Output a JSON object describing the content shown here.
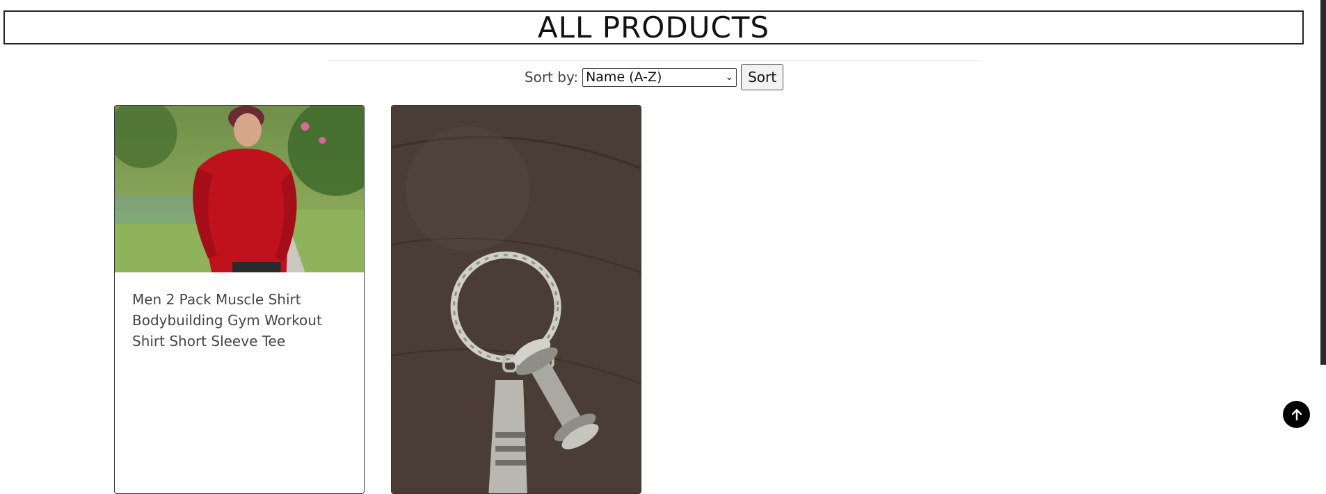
{
  "page": {
    "title": "ALL PRODUCTS"
  },
  "sort": {
    "label": "Sort by:",
    "selected": "Name (A-Z)",
    "button_label": "Sort"
  },
  "products": [
    {
      "name": "Men 2 Pack Muscle Shirt Bodybuilding Gym Workout Shirt Short Sleeve Tee",
      "image": "man-in-red-shirt-photo"
    },
    {
      "name": "",
      "image": "dumbbell-keychain-photo"
    }
  ],
  "icons": {
    "scroll_top": "arrow-up-icon"
  },
  "colors": {
    "accent": "#000000",
    "shirt_red": "#c0121c",
    "wood": "#4a3d36"
  }
}
